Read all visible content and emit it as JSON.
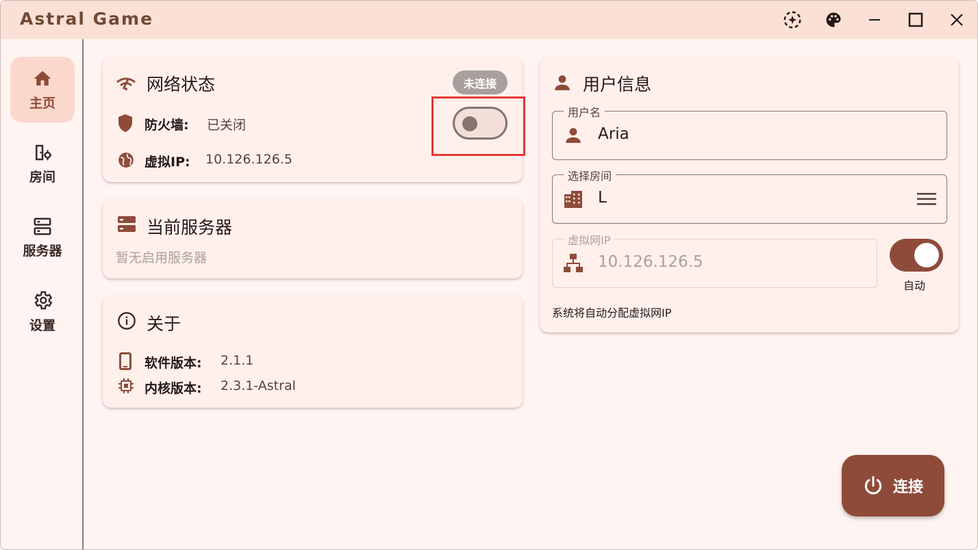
{
  "app": {
    "title": "Astral Game"
  },
  "window_controls": {
    "icons": [
      "sparkle-loading-icon",
      "palette-icon",
      "minimize-icon",
      "maximize-icon",
      "close-icon"
    ]
  },
  "sidebar": {
    "items": [
      {
        "label": "主页",
        "icon": "home-icon",
        "active": true
      },
      {
        "label": "房间",
        "icon": "room-door-icon",
        "active": false
      },
      {
        "label": "服务器",
        "icon": "server-icon",
        "active": false
      },
      {
        "label": "设置",
        "icon": "gear-icon",
        "active": false
      }
    ]
  },
  "network_card": {
    "title": "网络状态",
    "status_badge": "未连接",
    "firewall_label": "防火墙:",
    "firewall_value": "已关闭",
    "virtual_ip_label": "虚拟IP:",
    "virtual_ip_value": "10.126.126.5",
    "firewall_toggle_on": false
  },
  "server_card": {
    "title": "当前服务器",
    "empty_text": "暂无启用服务器"
  },
  "about_card": {
    "title": "关于",
    "software_version_label": "软件版本:",
    "software_version_value": "2.1.1",
    "kernel_version_label": "内核版本:",
    "kernel_version_value": "2.3.1-Astral"
  },
  "user_card": {
    "title": "用户信息",
    "username_label": "用户名",
    "username_value": "Aria",
    "room_label": "选择房间",
    "room_value": "L",
    "vip_label": "虚拟网IP",
    "vip_value": "10.126.126.5",
    "auto_label": "自动",
    "auto_on": true,
    "hint": "系统将自动分配虚拟网IP"
  },
  "connect_button": {
    "label": "连接"
  },
  "colors": {
    "accent": "#8e4b39",
    "titlebar_bg": "#fbe0d6",
    "page_bg": "#fff4f1",
    "highlight": "#e53935"
  }
}
